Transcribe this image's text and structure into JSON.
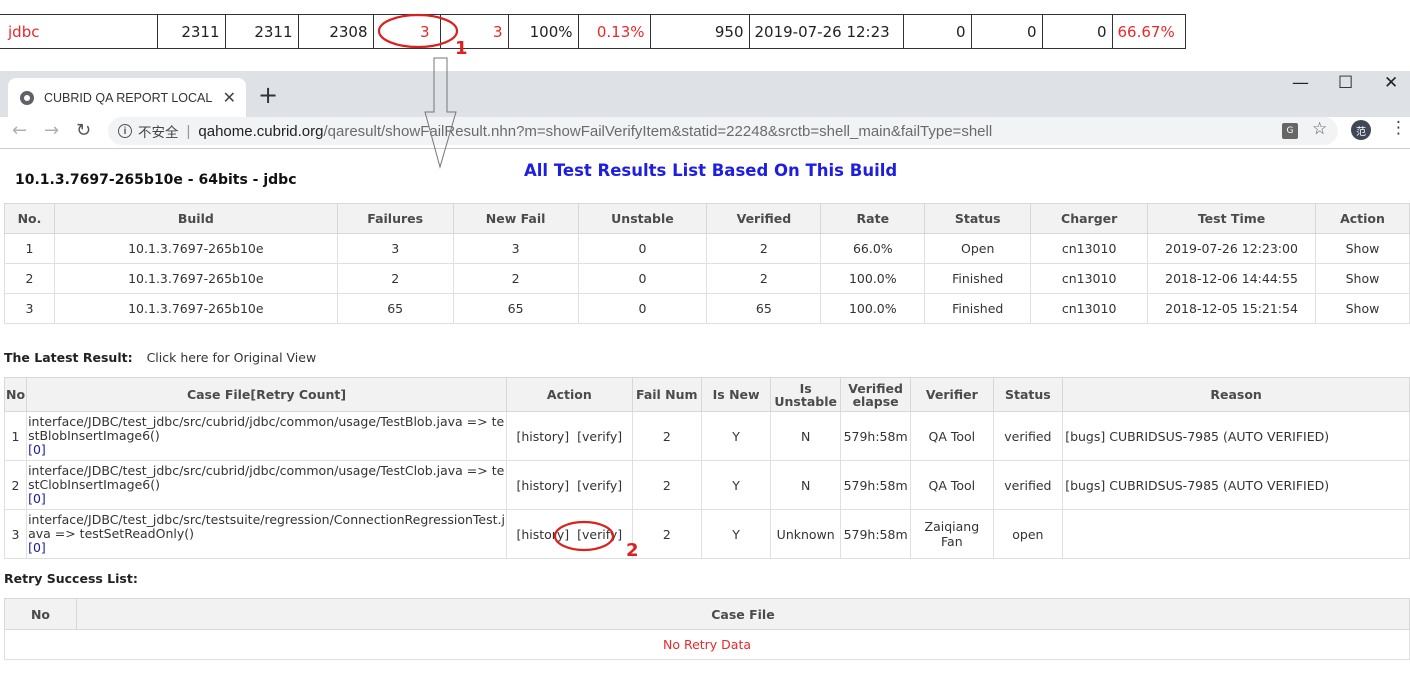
{
  "summary_row": [
    "jdbc",
    "2311",
    "2311",
    "2308",
    "3",
    "3",
    "100%",
    "0.13%",
    "950",
    "2019-07-26 12:23",
    "0",
    "0",
    "0",
    "66.67%"
  ],
  "annotations": {
    "label_1": "1",
    "label_2": "2",
    "accent": "#d9221f"
  },
  "browser": {
    "tab_title": "CUBRID QA REPORT LOCAL",
    "tab_close": "✕",
    "new_tab": "+",
    "minimize": "—",
    "maximize": "☐",
    "close": "✕",
    "insecure_label": "不安全",
    "url_host": "qahome.cubrid.org",
    "url_path": "/qaresult/showFailResult.nhn?m=showFailVerifyItem&statid=22248&srctb=shell_main&failType=shell",
    "avatar_text": "范"
  },
  "page": {
    "build_title": "10.1.3.7697-265b10e - 64bits - jdbc",
    "heading": "All Test Results List Based On This Build",
    "heading_color": "#1e1ee0"
  },
  "results_table": {
    "headers": [
      "No.",
      "Build",
      "Failures",
      "New Fail",
      "Unstable",
      "Verified",
      "Rate",
      "Status",
      "Charger",
      "Test Time",
      "Action"
    ],
    "rows": [
      [
        "1",
        "10.1.3.7697-265b10e",
        "3",
        "3",
        "0",
        "2",
        "66.0%",
        "Open",
        "cn13010",
        "2019-07-26 12:23:00",
        "Show"
      ],
      [
        "2",
        "10.1.3.7697-265b10e",
        "2",
        "2",
        "0",
        "2",
        "100.0%",
        "Finished",
        "cn13010",
        "2018-12-06 14:44:55",
        "Show"
      ],
      [
        "3",
        "10.1.3.7697-265b10e",
        "65",
        "65",
        "0",
        "65",
        "100.0%",
        "Finished",
        "cn13010",
        "2018-12-05 15:21:54",
        "Show"
      ]
    ]
  },
  "latest": {
    "label": "The Latest Result:",
    "link": "Click here for Original View"
  },
  "cases_table": {
    "headers": [
      "No",
      "Case File[Retry Count]",
      "Action",
      "Fail Num",
      "Is New",
      "Is Unstable",
      "Verified elapse",
      "Verifier",
      "Status",
      "Reason"
    ],
    "header_lines": {
      "is_unstable": [
        "Is",
        "Unstable"
      ],
      "verified_elapse": [
        "Verified",
        "elapse"
      ]
    },
    "rows": [
      {
        "no": "1",
        "file_l1": "interface/JDBC/test_jdbc/src/cubrid/jdbc/common/usage/TestBlob.java => te",
        "file_l2": "stBlobInsertImage6()",
        "retry": "[0]",
        "history": "[history]",
        "verify": "[verify]",
        "fail_num": "2",
        "is_new": "Y",
        "unstable": "N",
        "elapse": "579h:58m",
        "verifier": "QA Tool",
        "status": "verified",
        "reason": "[bugs] CUBRIDSUS-7985   (AUTO VERIFIED)"
      },
      {
        "no": "2",
        "file_l1": "interface/JDBC/test_jdbc/src/cubrid/jdbc/common/usage/TestClob.java => te",
        "file_l2": "stClobInsertImage6()",
        "retry": "[0]",
        "history": "[history]",
        "verify": "[verify]",
        "fail_num": "2",
        "is_new": "Y",
        "unstable": "N",
        "elapse": "579h:58m",
        "verifier": "QA Tool",
        "status": "verified",
        "reason": "[bugs] CUBRIDSUS-7985   (AUTO VERIFIED)"
      },
      {
        "no": "3",
        "file_l1": "interface/JDBC/test_jdbc/src/testsuite/regression/ConnectionRegressionTest.j",
        "file_l2": "ava => testSetReadOnly()",
        "retry": "[0]",
        "history": "[history]",
        "verify": "[verify]",
        "fail_num": "2",
        "is_new": "Y",
        "unstable": "Unknown",
        "elapse": "579h:58m",
        "verifier": "Zaiqiang Fan",
        "status": "open",
        "reason": ""
      }
    ]
  },
  "retry": {
    "title": "Retry Success List:",
    "headers": [
      "No",
      "Case File"
    ],
    "empty": "No Retry Data"
  }
}
